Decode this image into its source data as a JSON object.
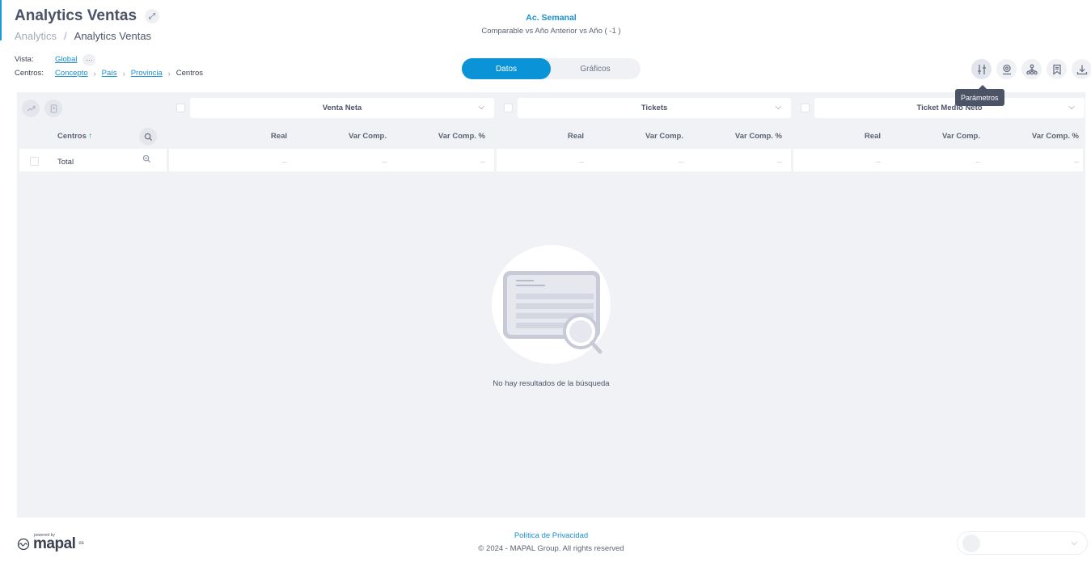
{
  "header": {
    "title": "Analytics Ventas",
    "breadcrumb": [
      "Analytics",
      "Analytics Ventas"
    ],
    "period_title": "Ac. Semanal",
    "period_subtitle": "Comparable vs Año Anterior vs Año ( -1 )"
  },
  "filters": {
    "vista_label": "Vista:",
    "vista_value": "Global",
    "centros_label": "Centros:",
    "centros_path": [
      "Concepto",
      "País",
      "Provincia",
      "Centros"
    ]
  },
  "view_toggle": {
    "options": [
      "Datos",
      "Gráficos"
    ],
    "selected": "Datos"
  },
  "toolbar": {
    "icons": [
      "sliders-icon",
      "location-pin-icon",
      "hierarchy-icon",
      "bookmark-icon",
      "download-icon"
    ],
    "tooltip": "Parámetros"
  },
  "table": {
    "first_column_header": "Centros",
    "sort_indicator": "↑",
    "metric_groups": [
      {
        "label": "Venta Neta",
        "columns": [
          "Real",
          "Var Comp.",
          "Var Comp. %"
        ]
      },
      {
        "label": "Tickets",
        "columns": [
          "Real",
          "Var Comp.",
          "Var Comp. %"
        ]
      },
      {
        "label": "Ticket Medio Neto",
        "columns": [
          "Real",
          "Var Comp.",
          "Var Comp. %"
        ]
      }
    ],
    "total_row": {
      "label": "Total",
      "values": [
        "--",
        "--",
        "--",
        "--",
        "--",
        "--",
        "--",
        "--",
        "--"
      ]
    }
  },
  "empty_state": {
    "message": "No hay resultados de la búsqueda"
  },
  "footer": {
    "powered_by": "powered by",
    "logo_word": "mapal",
    "logo_suffix": "os",
    "privacy": "Política de Privacidad",
    "copyright": "© 2024 - MAPAL Group. All rights reserved"
  },
  "colors": {
    "accent": "#0a93d6",
    "link": "#1a8fd0",
    "panel": "#f1f2f5",
    "tooltip": "#4b5467"
  }
}
